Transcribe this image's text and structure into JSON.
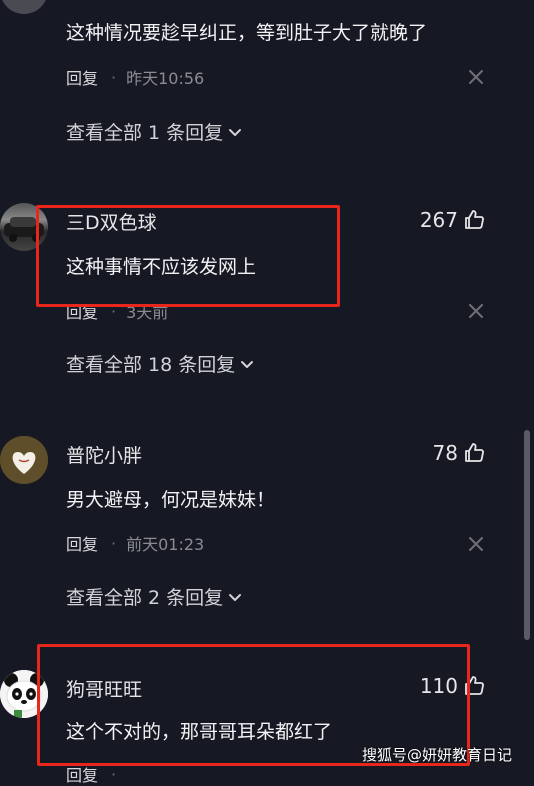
{
  "comments": [
    {
      "content": "这种情况要趁早纠正，等到肚子大了就晚了",
      "reply_label": "回复",
      "time": "昨天10:56",
      "expand_label": "查看全部 1 条回复"
    },
    {
      "username": "三D双色球",
      "likes": "267",
      "content": "这种事情不应该发网上",
      "reply_label": "回复",
      "time": "3天前",
      "expand_label": "查看全部 18 条回复"
    },
    {
      "username": "普陀小胖",
      "likes": "78",
      "content": "男大避母，何况是妹妹！",
      "reply_label": "回复",
      "time": "前天01:23",
      "expand_label": "查看全部 2 条回复"
    },
    {
      "username": "狗哥旺旺",
      "likes": "110",
      "content": "这个不对的，那哥哥耳朵都红了",
      "reply_label": "回复",
      "time": "·"
    }
  ],
  "watermark": "搜狐号@妍妍教育日记",
  "colors": {
    "background": "#161823",
    "highlight_box": "#e8261c",
    "secondary_text": "#8a8b93"
  },
  "icons": {
    "like": "thumbs-up-icon",
    "close": "close-icon",
    "expand": "chevron-down-icon"
  }
}
